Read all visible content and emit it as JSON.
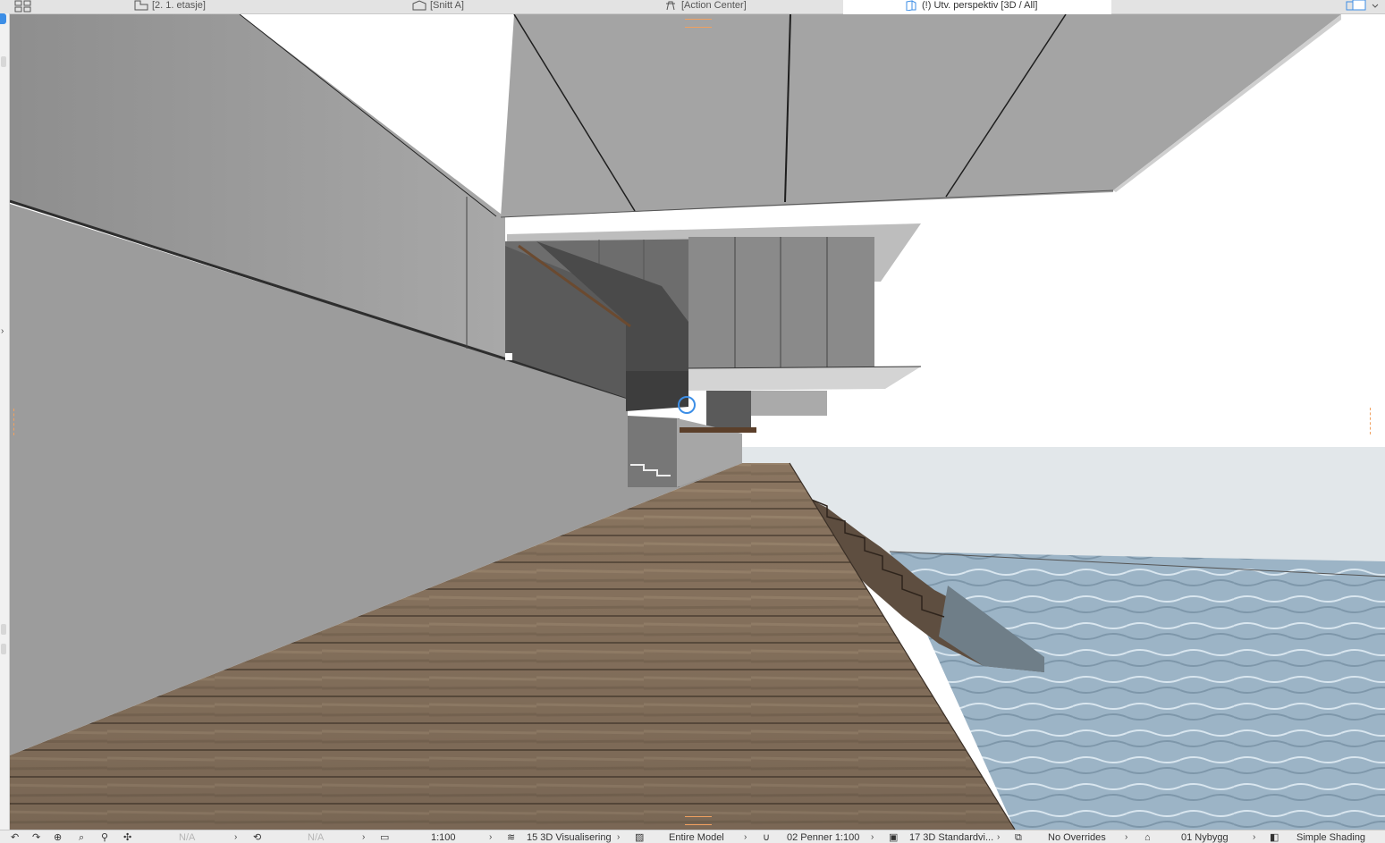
{
  "tabs": [
    {
      "label": "[2. 1. etasje]",
      "icon": "floor-plan-icon",
      "active": false
    },
    {
      "label": "[Snitt A]",
      "icon": "section-icon",
      "active": false
    },
    {
      "label": "[Action Center]",
      "icon": "action-center-icon",
      "active": false
    },
    {
      "label": "(!) Utv. perspektiv [3D / All]",
      "icon": "3d-view-icon",
      "active": true
    }
  ],
  "statusbar": {
    "zoom_na": "N/A",
    "angle_na": "N/A",
    "scale": "1:100",
    "layer_combination": "15 3D Visualisering",
    "model_filter": "Entire Model",
    "pen_set": "02 Penner 1:100",
    "model_view_options": "17 3D Standardvi...",
    "graphic_overrides": "No Overrides",
    "renovation_filter": "01 Nybygg",
    "shading": "Simple Shading"
  },
  "colors": {
    "active_blue": "#3c8ee6",
    "handle_orange": "#f0a060",
    "water": "#9eb5c6",
    "deck": "#8a7560",
    "concrete": "#9d9d9d"
  }
}
